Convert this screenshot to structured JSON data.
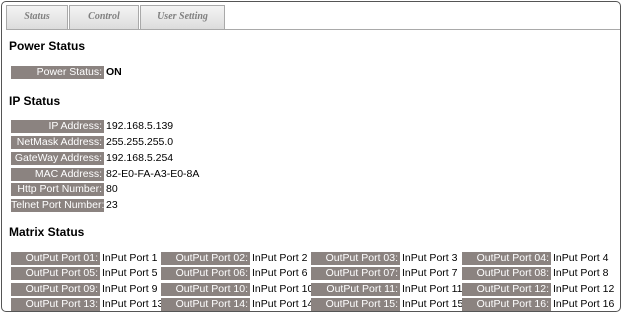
{
  "tabs": [
    {
      "label": "Status"
    },
    {
      "label": "Control"
    },
    {
      "label": "User Setting"
    }
  ],
  "power": {
    "heading": "Power Status",
    "label": "Power Status:",
    "value": "ON"
  },
  "ip": {
    "heading": "IP Status",
    "rows": [
      {
        "label": "IP Address:",
        "value": "192.168.5.139"
      },
      {
        "label": "NetMask Address:",
        "value": "255.255.255.0"
      },
      {
        "label": "GateWay Address:",
        "value": "192.168.5.254"
      },
      {
        "label": "MAC Address:",
        "value": "82-E0-FA-A3-E0-8A"
      },
      {
        "label": "Http Port Number:",
        "value": "80"
      },
      {
        "label": "Telnet Port Number:",
        "value": "23"
      }
    ]
  },
  "matrix": {
    "heading": "Matrix Status",
    "ports": [
      {
        "label": "OutPut Port 01:",
        "value": "InPut Port 1"
      },
      {
        "label": "OutPut Port 02:",
        "value": "InPut Port 2"
      },
      {
        "label": "OutPut Port 03:",
        "value": "InPut Port 3"
      },
      {
        "label": "OutPut Port 04:",
        "value": "InPut Port 4"
      },
      {
        "label": "OutPut Port 05:",
        "value": "InPut Port 5"
      },
      {
        "label": "OutPut Port 06:",
        "value": "InPut Port 6"
      },
      {
        "label": "OutPut Port 07:",
        "value": "InPut Port 7"
      },
      {
        "label": "OutPut Port 08:",
        "value": "InPut Port 8"
      },
      {
        "label": "OutPut Port 09:",
        "value": "InPut Port 9"
      },
      {
        "label": "OutPut Port 10:",
        "value": "InPut Port 10"
      },
      {
        "label": "OutPut Port 11:",
        "value": "InPut Port 11"
      },
      {
        "label": "OutPut Port 12:",
        "value": "InPut Port 12"
      },
      {
        "label": "OutPut Port 13:",
        "value": "InPut Port 13"
      },
      {
        "label": "OutPut Port 14:",
        "value": "InPut Port 14"
      },
      {
        "label": "OutPut Port 15:",
        "value": "InPut Port 15"
      },
      {
        "label": "OutPut Port 16:",
        "value": "InPut Port 16"
      }
    ]
  }
}
